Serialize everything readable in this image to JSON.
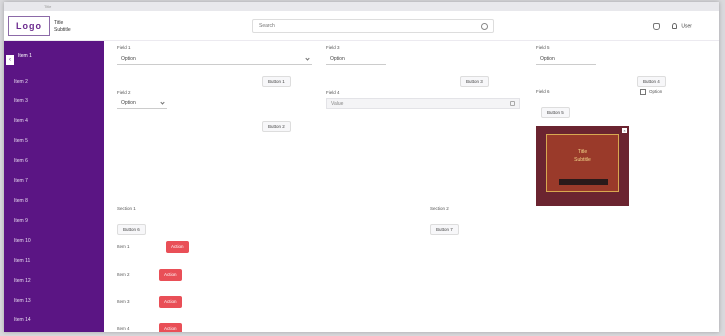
{
  "strip": {
    "text": "Title"
  },
  "header": {
    "logo": "Logo",
    "brand_line1": "Title",
    "brand_line2": "Subtitle",
    "search_placeholder": "Search",
    "user_label": "User"
  },
  "sidebar": {
    "items": [
      {
        "label": "Item 1"
      },
      {
        "label": "Item 2"
      },
      {
        "label": "Item 3"
      },
      {
        "label": "Item 4"
      },
      {
        "label": "Item 5"
      },
      {
        "label": "Item 6"
      },
      {
        "label": "Item 7"
      },
      {
        "label": "Item 8"
      },
      {
        "label": "Item 9"
      },
      {
        "label": "Item 10"
      },
      {
        "label": "Item 11"
      },
      {
        "label": "Item 12"
      },
      {
        "label": "Item 13"
      },
      {
        "label": "Item 14"
      }
    ]
  },
  "form": {
    "col1": {
      "label1": "Field 1",
      "select1": "Option",
      "button1": "Button 1",
      "label2": "Field 2",
      "select2": "Option",
      "button2": "Button 2"
    },
    "col2": {
      "label1": "Field 3",
      "select1": "Option",
      "button1": "Button 3",
      "label2": "Field 4",
      "input2": "Value"
    },
    "col3": {
      "label1": "Field 5",
      "select1": "Option",
      "button1": "Button 4",
      "label2": "Field 6",
      "checkbox_label": "Option",
      "button2": "Button 5"
    },
    "cover": {
      "line1": "Title",
      "line2": "Subtitle"
    }
  },
  "section_left": {
    "title": "Section 1",
    "button": "Button 6",
    "rows": [
      {
        "label": "Item 1",
        "action": "Action"
      },
      {
        "label": "Item 2",
        "action": "Action"
      },
      {
        "label": "Item 3",
        "action": "Action"
      },
      {
        "label": "Item 4",
        "action": "Action"
      }
    ]
  },
  "section_right": {
    "title": "Section 2",
    "button": "Button 7"
  },
  "colors": {
    "sidebar": "#5b1584",
    "danger": "#e94f57",
    "brand": "#6b2a8e"
  }
}
